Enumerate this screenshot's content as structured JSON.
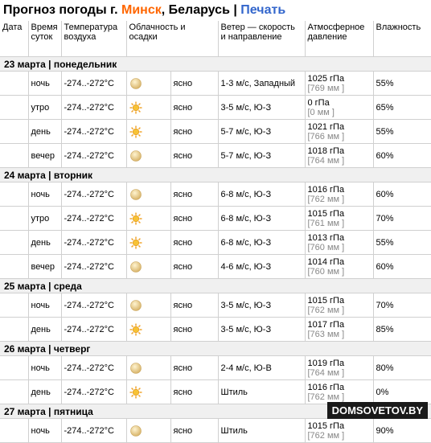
{
  "header": {
    "prefix": "Прогноз погоды г.",
    "city": "Минск",
    "country": ", Беларусь",
    "sep": "|",
    "print": "Печать"
  },
  "columns": [
    "Дата",
    "Время суток",
    "Температура воздуха",
    "Облачность и осадки",
    "Ветер — скорость и направление",
    "Атмосферное давление",
    "Влажность"
  ],
  "days": [
    {
      "label": "23 марта | понедельник",
      "rows": [
        {
          "time": "ночь",
          "temp": "-274..-272°C",
          "icon": "moon",
          "sky": "ясно",
          "wind": "1-3 м/с, Западный",
          "p1": "1025 гПа",
          "p2": "[769 мм ]",
          "hum": "55%"
        },
        {
          "time": "утро",
          "temp": "-274..-272°C",
          "icon": "sun",
          "sky": "ясно",
          "wind": "3-5 м/с, Ю-З",
          "p1": "0 гПа",
          "p2": "[0 мм ]",
          "hum": "65%"
        },
        {
          "time": "день",
          "temp": "-274..-272°C",
          "icon": "sun",
          "sky": "ясно",
          "wind": "5-7 м/с, Ю-З",
          "p1": "1021 гПа",
          "p2": "[766 мм ]",
          "hum": "55%"
        },
        {
          "time": "вечер",
          "temp": "-274..-272°C",
          "icon": "moon",
          "sky": "ясно",
          "wind": "5-7 м/с, Ю-З",
          "p1": "1018 гПа",
          "p2": "[764 мм ]",
          "hum": "60%"
        }
      ]
    },
    {
      "label": "24 марта | вторник",
      "rows": [
        {
          "time": "ночь",
          "temp": "-274..-272°C",
          "icon": "moon",
          "sky": "ясно",
          "wind": "6-8 м/с, Ю-З",
          "p1": "1016 гПа",
          "p2": "[762 мм ]",
          "hum": "60%"
        },
        {
          "time": "утро",
          "temp": "-274..-272°C",
          "icon": "sun",
          "sky": "ясно",
          "wind": "6-8 м/с, Ю-З",
          "p1": "1015 гПа",
          "p2": "[761 мм ]",
          "hum": "70%"
        },
        {
          "time": "день",
          "temp": "-274..-272°C",
          "icon": "sun",
          "sky": "ясно",
          "wind": "6-8 м/с, Ю-З",
          "p1": "1013 гПа",
          "p2": "[760 мм ]",
          "hum": "55%"
        },
        {
          "time": "вечер",
          "temp": "-274..-272°C",
          "icon": "moon",
          "sky": "ясно",
          "wind": "4-6 м/с, Ю-З",
          "p1": "1014 гПа",
          "p2": "[760 мм ]",
          "hum": "60%"
        }
      ]
    },
    {
      "label": "25 марта | среда",
      "rows": [
        {
          "time": "ночь",
          "temp": "-274..-272°C",
          "icon": "moon",
          "sky": "ясно",
          "wind": "3-5 м/с, Ю-З",
          "p1": "1015 гПа",
          "p2": "[762 мм ]",
          "hum": "70%"
        },
        {
          "time": "день",
          "temp": "-274..-272°C",
          "icon": "sun",
          "sky": "ясно",
          "wind": "3-5 м/с, Ю-З",
          "p1": "1017 гПа",
          "p2": "[763 мм ]",
          "hum": "85%"
        }
      ]
    },
    {
      "label": "26 марта | четверг",
      "rows": [
        {
          "time": "ночь",
          "temp": "-274..-272°C",
          "icon": "moon",
          "sky": "ясно",
          "wind": "2-4 м/с, Ю-В",
          "p1": "1019 гПа",
          "p2": "[764 мм ]",
          "hum": "80%"
        },
        {
          "time": "день",
          "temp": "-274..-272°C",
          "icon": "sun",
          "sky": "ясно",
          "wind": "Штиль",
          "p1": "1016 гПа",
          "p2": "[762 мм ]",
          "hum": "0%"
        }
      ]
    },
    {
      "label": "27 марта | пятница",
      "rows": [
        {
          "time": "ночь",
          "temp": "-274..-272°C",
          "icon": "moon",
          "sky": "ясно",
          "wind": "Штиль",
          "p1": "1015 гПа",
          "p2": "[762 мм ]",
          "hum": "90%"
        }
      ]
    }
  ],
  "watermark": "DOMSOVETOV.BY"
}
